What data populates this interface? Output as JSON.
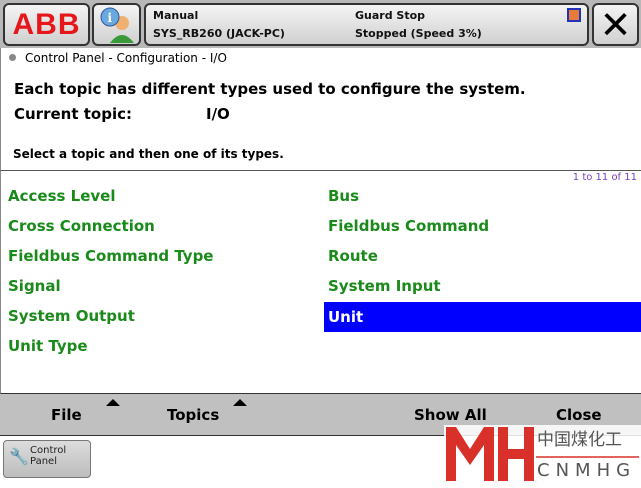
{
  "header": {
    "logo": "ABB",
    "mode": "Manual",
    "system": "SYS_RB260 (JACK-PC)",
    "guard": "Guard Stop",
    "state": "Stopped (Speed 3%)"
  },
  "breadcrumb": "Control Panel - Configuration - I/O",
  "description": {
    "line1": "Each topic has different types used to configure the system.",
    "topic_label": "Current topic:",
    "topic_value": "I/O",
    "instruction": "Select a topic and then one of its types."
  },
  "list": {
    "count": "1 to 11 of 11",
    "items": [
      "Access Level",
      "Bus",
      "Cross Connection",
      "Fieldbus Command",
      "Fieldbus Command Type",
      "Route",
      "Signal",
      "System Input",
      "System Output",
      "Unit",
      "Unit Type"
    ],
    "selected": "Unit"
  },
  "commands": {
    "file": "File",
    "topics": "Topics",
    "show_all": "Show All",
    "close": "Close"
  },
  "taskbar": {
    "control_panel_line1": "Control",
    "control_panel_line2": "Panel"
  },
  "watermark": {
    "cn": "中国煤化工",
    "en": "CNMHG"
  },
  "colors": {
    "selected": "#0000ff",
    "item": "#1a8a1a",
    "logo": "#e5171b"
  }
}
